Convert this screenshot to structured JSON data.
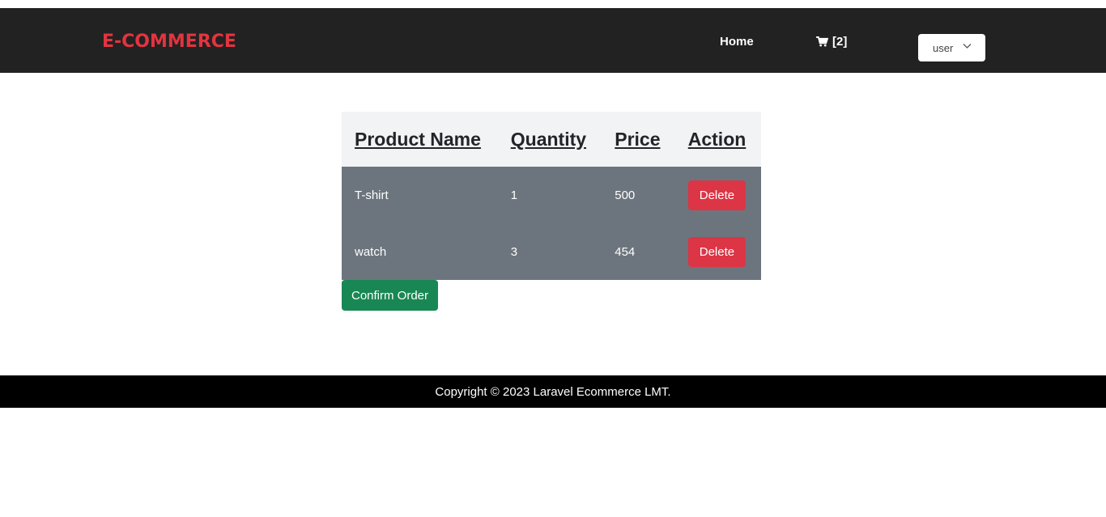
{
  "navbar": {
    "brand": "E-COMMERCE",
    "home_label": "Home",
    "cart_icon": "shopping-cart-icon",
    "cart_count_label": "[2]",
    "user_label": "user",
    "dropdown_icon": "chevron-down-icon",
    "brand_color": "#e3343f",
    "background": "#222222"
  },
  "cart": {
    "columns": [
      "Product Name",
      "Quantity",
      "Price",
      "Action"
    ],
    "rows": [
      {
        "product": "T-shirt",
        "quantity": "1",
        "price": "500",
        "action_label": "Delete"
      },
      {
        "product": "watch",
        "quantity": "3",
        "price": "454",
        "action_label": "Delete"
      }
    ],
    "confirm_label": "Confirm Order"
  },
  "colors": {
    "danger": "#dc3545",
    "success": "#198754",
    "row_bg": "#6c757d",
    "header_bg": "#f2f3f5"
  },
  "footer": {
    "text": "Copyright © 2023 Laravel Ecommerce LMT."
  }
}
